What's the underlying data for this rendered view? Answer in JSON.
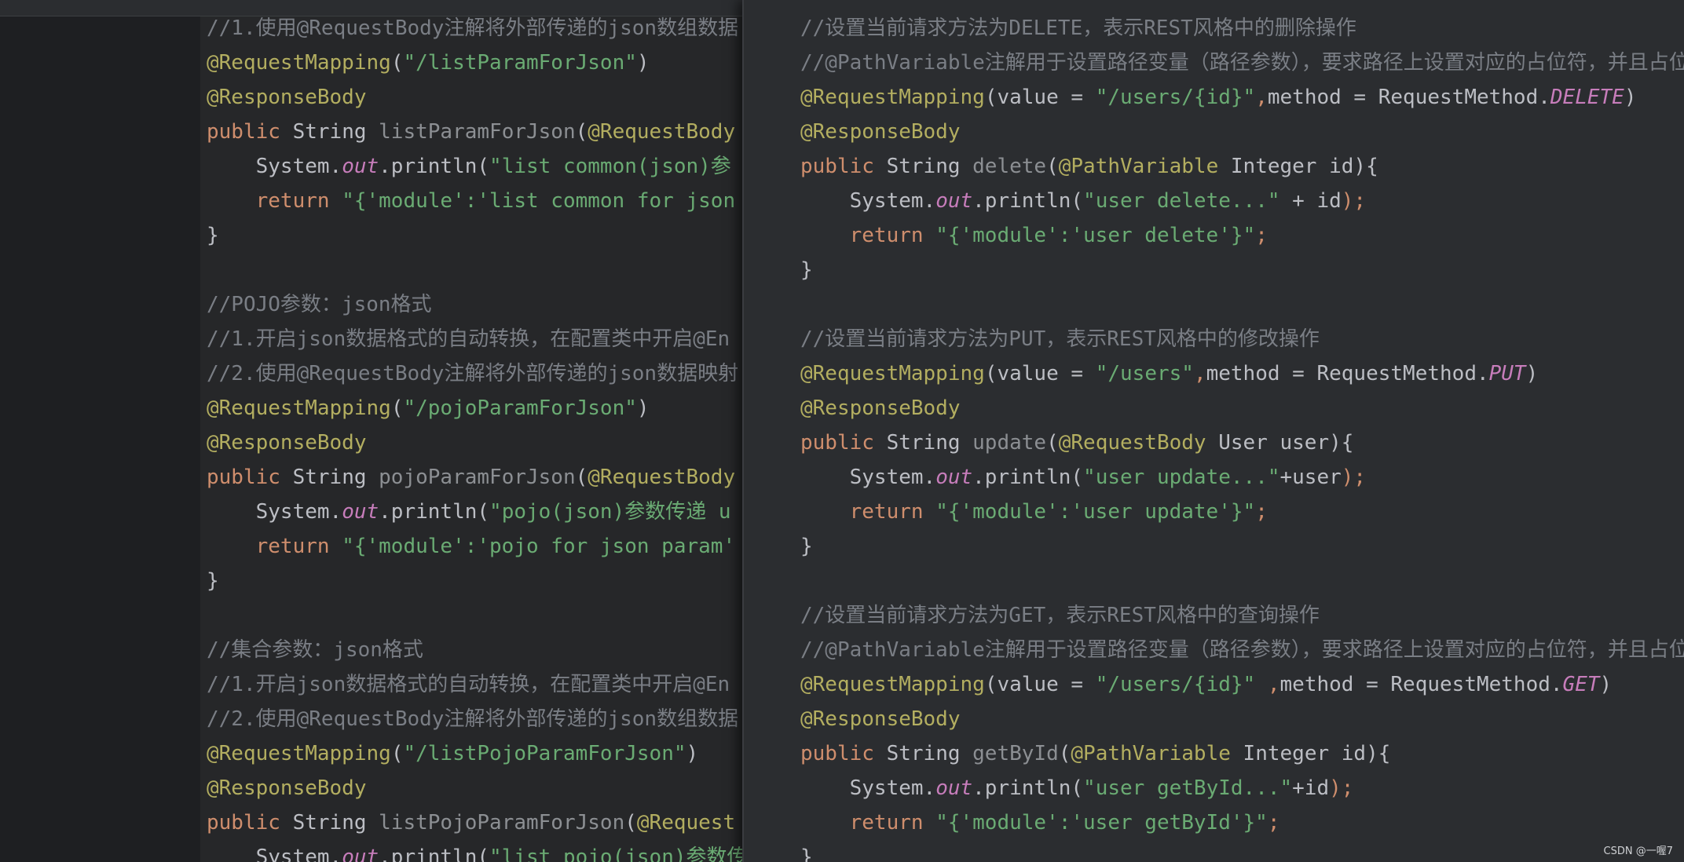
{
  "left_pane": {
    "lines": [
      [
        [
          "comment",
          "//1.使用@RequestBody注解将外部传递的json数组数据"
        ]
      ],
      [
        [
          "annot",
          "@RequestMapping"
        ],
        [
          "plain",
          "("
        ],
        [
          "str",
          "\"/listParamForJson\""
        ],
        [
          "plain",
          ")"
        ]
      ],
      [
        [
          "annot",
          "@ResponseBody"
        ]
      ],
      [
        [
          "kw",
          "public "
        ],
        [
          "plain",
          "String "
        ],
        [
          "muted",
          "listParamForJson"
        ],
        [
          "plain",
          "("
        ],
        [
          "annot",
          "@RequestBody"
        ]
      ],
      [
        [
          "plain",
          "    System."
        ],
        [
          "static",
          "out"
        ],
        [
          "plain",
          ".println("
        ],
        [
          "str",
          "\"list common(json)参"
        ]
      ],
      [
        [
          "kw",
          "    return "
        ],
        [
          "str",
          "\"{'module':'list common for json"
        ]
      ],
      [
        [
          "plain",
          "}"
        ]
      ],
      [
        [
          "plain",
          ""
        ]
      ],
      [
        [
          "comment",
          "//POJO参数：json格式"
        ]
      ],
      [
        [
          "comment",
          "//1.开启json数据格式的自动转换，在配置类中开启@En"
        ]
      ],
      [
        [
          "comment",
          "//2.使用@RequestBody注解将外部传递的json数据映射"
        ]
      ],
      [
        [
          "annot",
          "@RequestMapping"
        ],
        [
          "plain",
          "("
        ],
        [
          "str",
          "\"/pojoParamForJson\""
        ],
        [
          "plain",
          ")"
        ]
      ],
      [
        [
          "annot",
          "@ResponseBody"
        ]
      ],
      [
        [
          "kw",
          "public "
        ],
        [
          "plain",
          "String "
        ],
        [
          "muted",
          "pojoParamForJson"
        ],
        [
          "plain",
          "("
        ],
        [
          "annot",
          "@RequestBody"
        ]
      ],
      [
        [
          "plain",
          "    System."
        ],
        [
          "static",
          "out"
        ],
        [
          "plain",
          ".println("
        ],
        [
          "str",
          "\"pojo(json)参数传递 u"
        ]
      ],
      [
        [
          "kw",
          "    return "
        ],
        [
          "str",
          "\"{'module':'pojo for json param'"
        ]
      ],
      [
        [
          "plain",
          "}"
        ]
      ],
      [
        [
          "plain",
          ""
        ]
      ],
      [
        [
          "comment",
          "//集合参数：json格式"
        ]
      ],
      [
        [
          "comment",
          "//1.开启json数据格式的自动转换，在配置类中开启@En"
        ]
      ],
      [
        [
          "comment",
          "//2.使用@RequestBody注解将外部传递的json数组数据"
        ]
      ],
      [
        [
          "annot",
          "@RequestMapping"
        ],
        [
          "plain",
          "("
        ],
        [
          "str",
          "\"/listPojoParamForJson\""
        ],
        [
          "plain",
          ")"
        ]
      ],
      [
        [
          "annot",
          "@ResponseBody"
        ]
      ],
      [
        [
          "kw",
          "public "
        ],
        [
          "plain",
          "String "
        ],
        [
          "muted",
          "listPojoParamForJson"
        ],
        [
          "plain",
          "("
        ],
        [
          "annot",
          "@Request"
        ]
      ],
      [
        [
          "plain",
          "    System."
        ],
        [
          "static",
          "out"
        ],
        [
          "plain",
          ".println("
        ],
        [
          "str",
          "\"list pojo(json)参数传"
        ]
      ]
    ]
  },
  "right_pane": {
    "lines": [
      [
        [
          "comment",
          "//设置当前请求方法为DELETE，表示REST风格中的删除操作"
        ]
      ],
      [
        [
          "comment",
          "//@PathVariable注解用于设置路径变量（路径参数），要求路径上设置对应的占位符，并且占位"
        ]
      ],
      [
        [
          "annot",
          "@RequestMapping"
        ],
        [
          "plain",
          "(value = "
        ],
        [
          "str",
          "\"/users/{id}\""
        ],
        [
          "kw",
          ","
        ],
        [
          "plain",
          "method = RequestMethod."
        ],
        [
          "enum",
          "DELETE"
        ],
        [
          "plain",
          ")"
        ]
      ],
      [
        [
          "annot",
          "@ResponseBody"
        ]
      ],
      [
        [
          "kw",
          "public "
        ],
        [
          "plain",
          "String "
        ],
        [
          "muted",
          "delete"
        ],
        [
          "plain",
          "("
        ],
        [
          "annot",
          "@PathVariable "
        ],
        [
          "plain",
          "Integer id){"
        ]
      ],
      [
        [
          "plain",
          "    System."
        ],
        [
          "static",
          "out"
        ],
        [
          "plain",
          ".println("
        ],
        [
          "str",
          "\"user delete...\""
        ],
        [
          "plain",
          " + id"
        ],
        [
          "kw",
          ");"
        ]
      ],
      [
        [
          "kw",
          "    return "
        ],
        [
          "str",
          "\"{'module':'user delete'}\""
        ],
        [
          "kw",
          ";"
        ]
      ],
      [
        [
          "plain",
          "}"
        ]
      ],
      [
        [
          "plain",
          ""
        ]
      ],
      [
        [
          "comment",
          "//设置当前请求方法为PUT，表示REST风格中的修改操作"
        ]
      ],
      [
        [
          "annot",
          "@RequestMapping"
        ],
        [
          "plain",
          "(value = "
        ],
        [
          "str",
          "\"/users\""
        ],
        [
          "kw",
          ","
        ],
        [
          "plain",
          "method = RequestMethod."
        ],
        [
          "enum",
          "PUT"
        ],
        [
          "plain",
          ")"
        ]
      ],
      [
        [
          "annot",
          "@ResponseBody"
        ]
      ],
      [
        [
          "kw",
          "public "
        ],
        [
          "plain",
          "String "
        ],
        [
          "muted",
          "update"
        ],
        [
          "plain",
          "("
        ],
        [
          "annot",
          "@RequestBody "
        ],
        [
          "plain",
          "User user){"
        ]
      ],
      [
        [
          "plain",
          "    System."
        ],
        [
          "static",
          "out"
        ],
        [
          "plain",
          ".println("
        ],
        [
          "str",
          "\"user update...\""
        ],
        [
          "plain",
          "+user"
        ],
        [
          "kw",
          ");"
        ]
      ],
      [
        [
          "kw",
          "    return "
        ],
        [
          "str",
          "\"{'module':'user update'}\""
        ],
        [
          "kw",
          ";"
        ]
      ],
      [
        [
          "plain",
          "}"
        ]
      ],
      [
        [
          "plain",
          ""
        ]
      ],
      [
        [
          "comment",
          "//设置当前请求方法为GET，表示REST风格中的查询操作"
        ]
      ],
      [
        [
          "comment",
          "//@PathVariable注解用于设置路径变量（路径参数），要求路径上设置对应的占位符，并且占位"
        ]
      ],
      [
        [
          "annot",
          "@RequestMapping"
        ],
        [
          "plain",
          "(value = "
        ],
        [
          "str",
          "\"/users/{id}\""
        ],
        [
          "kw",
          " ,"
        ],
        [
          "plain",
          "method = RequestMethod."
        ],
        [
          "enum",
          "GET"
        ],
        [
          "plain",
          ")"
        ]
      ],
      [
        [
          "annot",
          "@ResponseBody"
        ]
      ],
      [
        [
          "kw",
          "public "
        ],
        [
          "plain",
          "String "
        ],
        [
          "muted",
          "getById"
        ],
        [
          "plain",
          "("
        ],
        [
          "annot",
          "@PathVariable "
        ],
        [
          "plain",
          "Integer id){"
        ]
      ],
      [
        [
          "plain",
          "    System."
        ],
        [
          "static",
          "out"
        ],
        [
          "plain",
          ".println("
        ],
        [
          "str",
          "\"user getById...\""
        ],
        [
          "plain",
          "+id"
        ],
        [
          "kw",
          ");"
        ]
      ],
      [
        [
          "kw",
          "    return "
        ],
        [
          "str",
          "\"{'module':'user getById'}\""
        ],
        [
          "kw",
          ";"
        ]
      ],
      [
        [
          "plain",
          "}"
        ]
      ]
    ]
  },
  "watermark": "CSDN @一喔7"
}
